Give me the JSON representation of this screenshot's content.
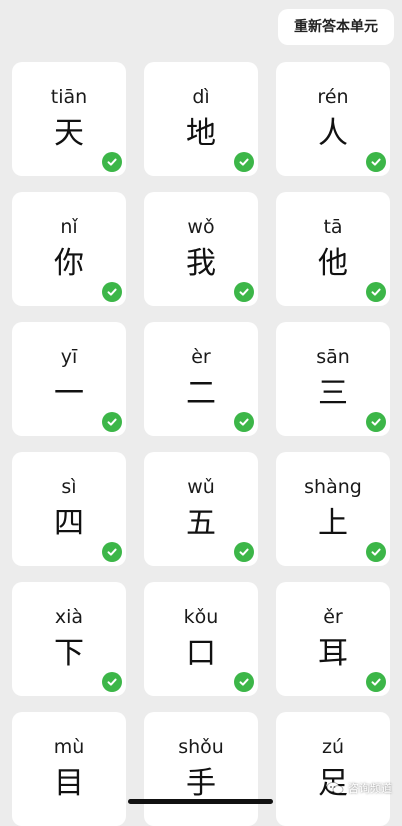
{
  "header": {
    "reanswer_label": "重新答本单元"
  },
  "cards": [
    {
      "pinyin": "tiān",
      "hanzi": "天",
      "checked": true
    },
    {
      "pinyin": "dì",
      "hanzi": "地",
      "checked": true
    },
    {
      "pinyin": "rén",
      "hanzi": "人",
      "checked": true
    },
    {
      "pinyin": "nǐ",
      "hanzi": "你",
      "checked": true
    },
    {
      "pinyin": "wǒ",
      "hanzi": "我",
      "checked": true
    },
    {
      "pinyin": "tā",
      "hanzi": "他",
      "checked": true
    },
    {
      "pinyin": "yī",
      "hanzi": "一",
      "checked": true
    },
    {
      "pinyin": "èr",
      "hanzi": "二",
      "checked": true
    },
    {
      "pinyin": "sān",
      "hanzi": "三",
      "checked": true
    },
    {
      "pinyin": "sì",
      "hanzi": "四",
      "checked": true
    },
    {
      "pinyin": "wǔ",
      "hanzi": "五",
      "checked": true
    },
    {
      "pinyin": "shàng",
      "hanzi": "上",
      "checked": true
    },
    {
      "pinyin": "xià",
      "hanzi": "下",
      "checked": true
    },
    {
      "pinyin": "kǒu",
      "hanzi": "口",
      "checked": true
    },
    {
      "pinyin": "ěr",
      "hanzi": "耳",
      "checked": true
    },
    {
      "pinyin": "mù",
      "hanzi": "目",
      "checked": false
    },
    {
      "pinyin": "shǒu",
      "hanzi": "手",
      "checked": false
    },
    {
      "pinyin": "zú",
      "hanzi": "足",
      "checked": false
    }
  ],
  "watermark": {
    "text": "咨询频道",
    "icon": "chat-bubble-icon"
  },
  "colors": {
    "background": "#ececec",
    "card": "#ffffff",
    "check": "#3cb648"
  }
}
